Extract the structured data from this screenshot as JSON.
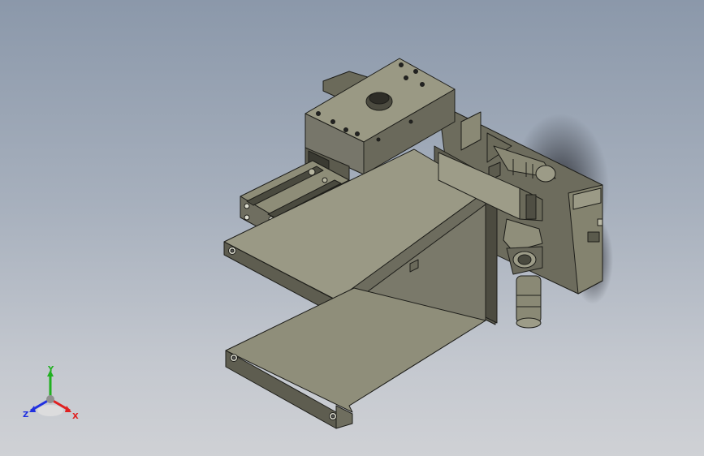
{
  "viewport": {
    "background_top": "#8b98aa",
    "background_bottom": "#cfd1d5"
  },
  "model": {
    "body_color": "#8a8975",
    "edge_color": "#1e1e1a",
    "shadow_color": "#24262b"
  },
  "triad": {
    "x_label": "X",
    "y_label": "Y",
    "z_label": "Z",
    "x_color": "#e02020",
    "y_color": "#20b020",
    "z_color": "#2030e0"
  }
}
